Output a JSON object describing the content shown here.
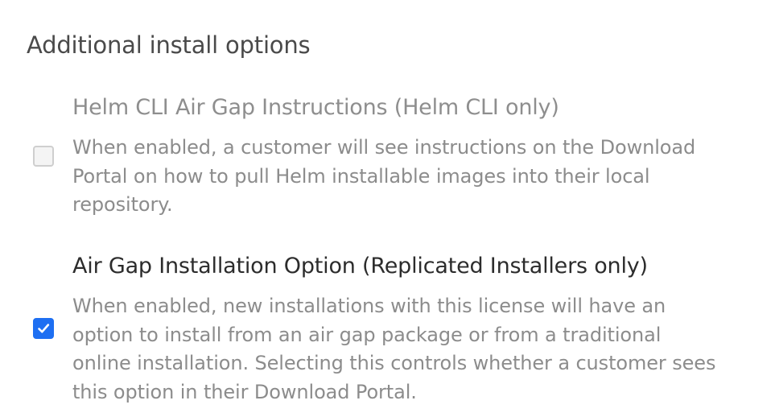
{
  "section": {
    "title": "Additional install options"
  },
  "options": [
    {
      "title": "Helm CLI Air Gap Instructions (Helm CLI only)",
      "checked": false,
      "disabled": true,
      "description_lines": [
        "When enabled, a customer will see instructions on the Download",
        "Portal on how to pull Helm installable images into their local",
        "repository."
      ]
    },
    {
      "title": "Air Gap Installation Option (Replicated Installers only)",
      "checked": true,
      "disabled": false,
      "description_lines": [
        "When enabled, new installations with this license will have an",
        "option to install from an air gap package or from a traditional",
        "online installation. Selecting this controls whether a customer sees",
        "this option in their Download Portal."
      ]
    }
  ],
  "colors": {
    "accent": "#1e6ff2",
    "text_primary": "#2c2c2c",
    "text_muted": "#8c8c8c",
    "heading": "#4a4a4a"
  },
  "icons": {
    "checked": "checkmark-icon"
  }
}
